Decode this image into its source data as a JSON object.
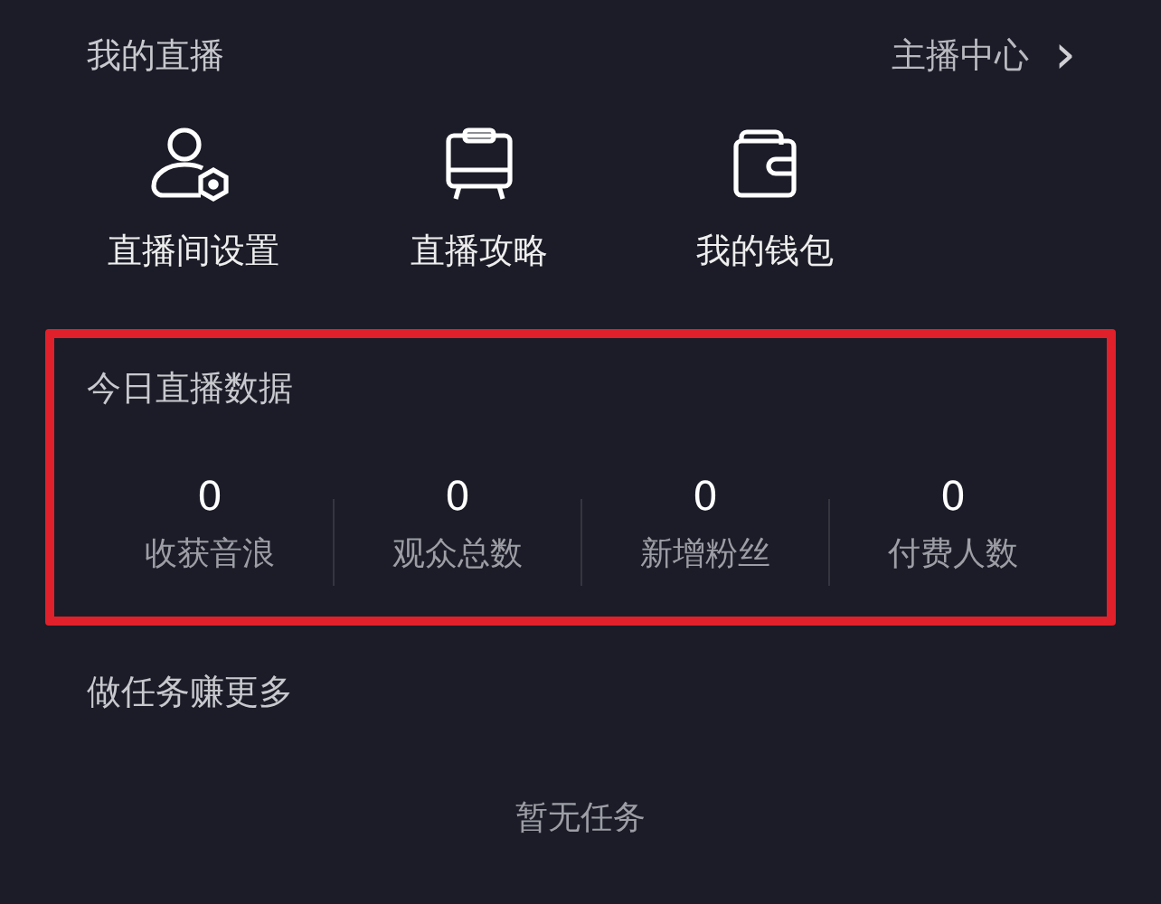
{
  "live_section": {
    "title": "我的直播",
    "link": "主播中心",
    "link_icon": "›",
    "shortcuts": [
      {
        "label": "直播间设置",
        "kind": "person"
      },
      {
        "label": "直播攻略",
        "kind": "board"
      },
      {
        "label": "我的钱包",
        "kind": "wallet"
      }
    ]
  },
  "today_stats": {
    "title": "今日直播数据",
    "highlighted": true,
    "stats": [
      {
        "value": "0",
        "label": "收获音浪"
      },
      {
        "value": "0",
        "label": "观众总数"
      },
      {
        "value": "0",
        "label": "新增粉丝"
      },
      {
        "value": "0",
        "label": "付费人数"
      }
    ]
  },
  "tasks": {
    "title": "做任务赚更多",
    "empty_text": "暂无任务"
  }
}
